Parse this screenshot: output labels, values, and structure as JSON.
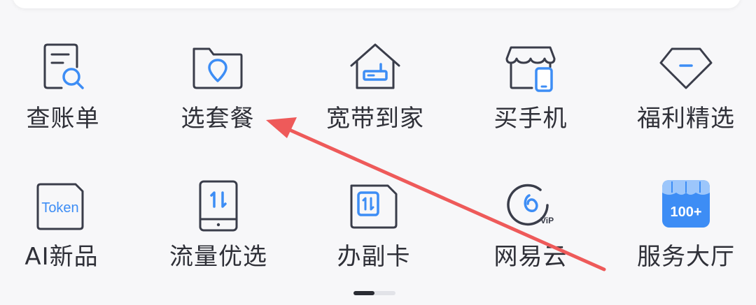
{
  "grid": {
    "row1": [
      {
        "label": "查账单",
        "icon": "bill-search-icon"
      },
      {
        "label": "选套餐",
        "icon": "plan-folder-icon"
      },
      {
        "label": "宽带到家",
        "icon": "broadband-home-icon"
      },
      {
        "label": "买手机",
        "icon": "phone-store-icon"
      },
      {
        "label": "福利精选",
        "icon": "diamond-icon"
      }
    ],
    "row2": [
      {
        "label": "AI新品",
        "icon": "token-icon",
        "icon_text": "Token"
      },
      {
        "label": "流量优选",
        "icon": "data-traffic-icon"
      },
      {
        "label": "办副卡",
        "icon": "sim-card-icon"
      },
      {
        "label": "网易云",
        "icon": "netease-cloud-vip-icon",
        "icon_text": "ViP"
      },
      {
        "label": "服务大厅",
        "icon": "service-hall-icon",
        "icon_text": "100+"
      }
    ]
  },
  "colors": {
    "icon_stroke": "#3a3d4a",
    "accent_blue": "#3d8df5",
    "arrow_red": "#ee5a5a"
  },
  "page_indicator": {
    "active_index": 0,
    "pages": 2
  }
}
